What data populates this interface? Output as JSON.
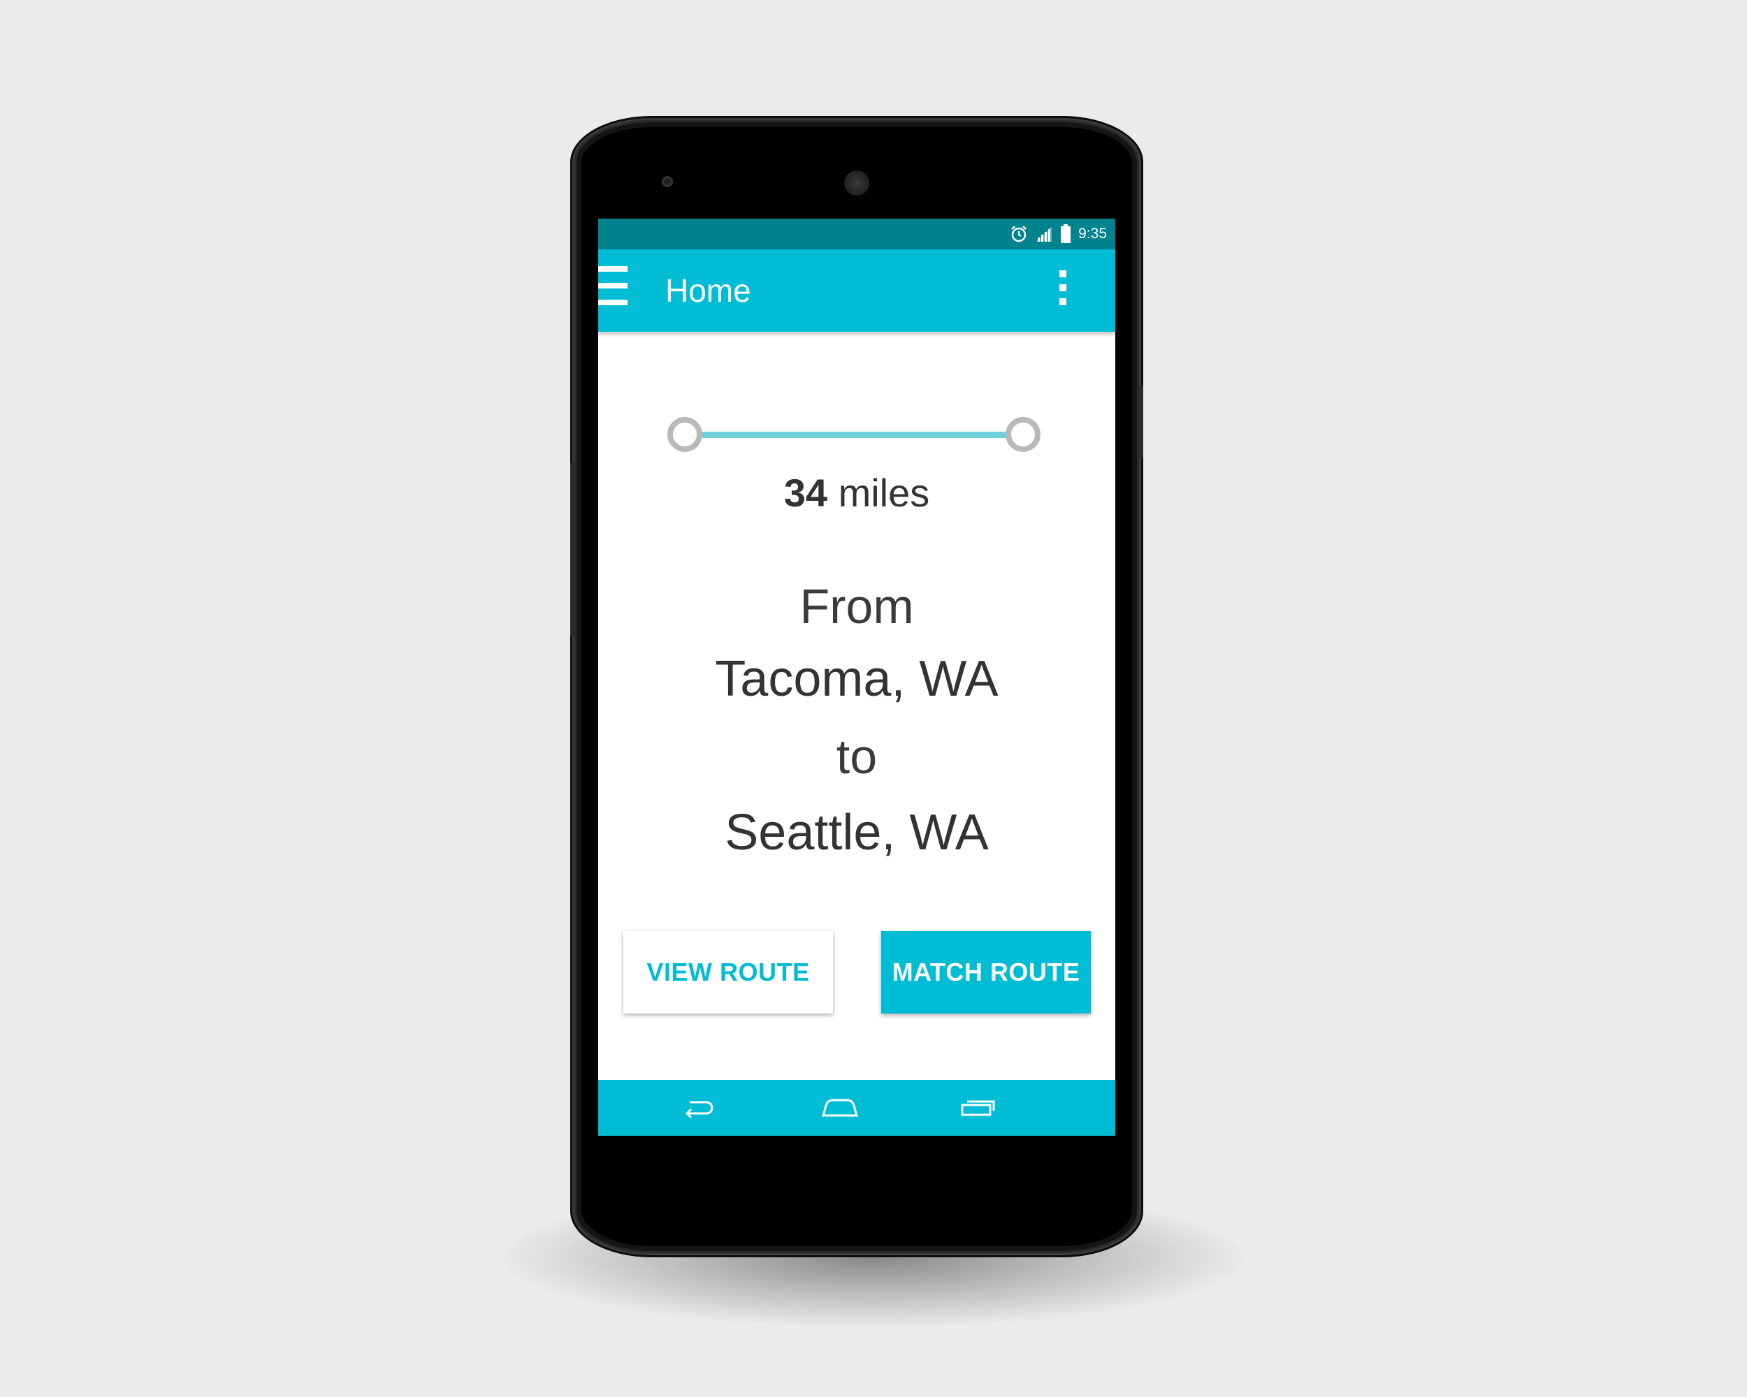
{
  "status_bar": {
    "time": "9:35",
    "icons": [
      "alarm-icon",
      "signal-icon",
      "battery-icon"
    ]
  },
  "app_bar": {
    "title": "Home",
    "menu_icon": "hamburger-menu-icon",
    "overflow_icon": "more-vert-icon"
  },
  "trip": {
    "distance_value": "34",
    "distance_unit": "miles",
    "from_label": "From",
    "origin": "Tacoma, WA",
    "to_label": "to",
    "destination": "Seattle, WA"
  },
  "actions": {
    "view_route": "VIEW ROUTE",
    "match_route": "MATCH ROUTE"
  },
  "nav_bar": {
    "icons": [
      "back-icon",
      "home-icon",
      "recent-apps-icon"
    ]
  },
  "colors": {
    "primary": "#00bcd4",
    "primary_dark": "#00838f",
    "route_line": "#70cfdc",
    "endpoint_ring": "#b9b9b9",
    "text": "#333333",
    "background": "#ebebeb"
  }
}
